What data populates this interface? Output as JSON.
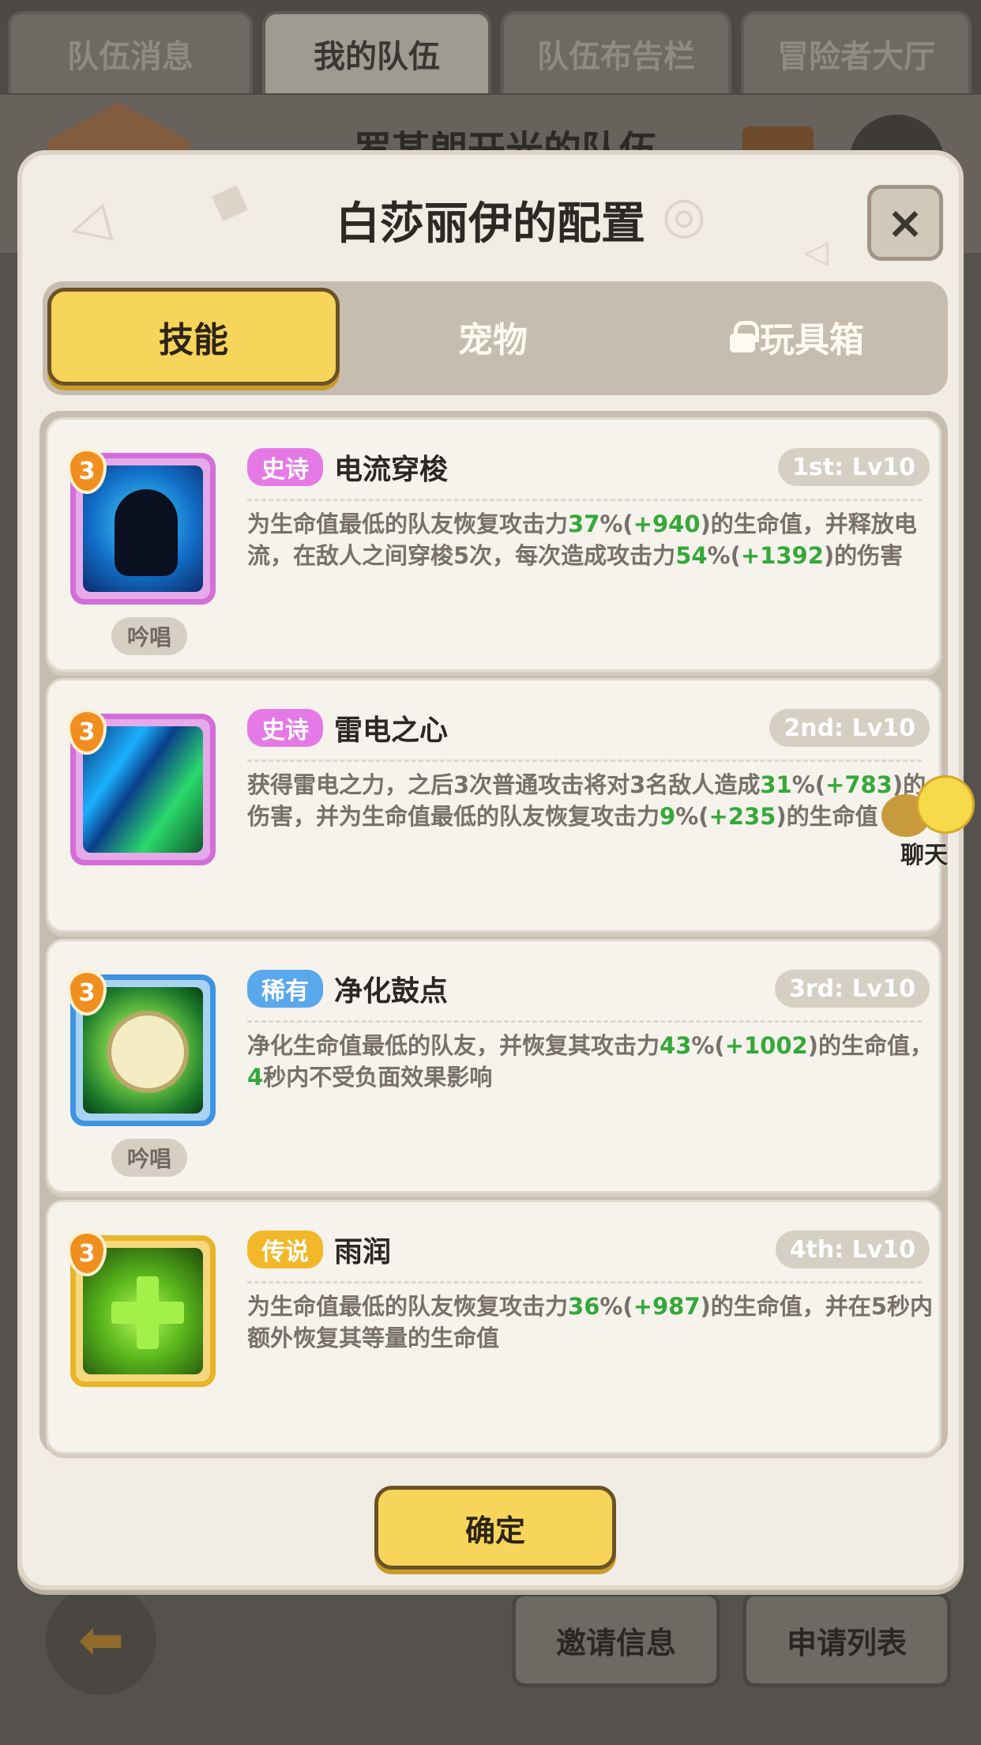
{
  "top_tabs": [
    "队伍消息",
    "我的队伍",
    "队伍布告栏",
    "冒险者大厅"
  ],
  "background": {
    "team_title": "罗某朗开光的队伍",
    "invite_button": "邀请信息",
    "apply_button": "申请列表"
  },
  "modal": {
    "title": "白莎丽伊的配置",
    "close_label": "×",
    "tabs": {
      "skills": "技能",
      "pets": "宠物",
      "toybox": "玩具箱"
    },
    "confirm_label": "确定"
  },
  "skills": [
    {
      "level": "3",
      "rarity": "史诗",
      "rarity_type": "epic",
      "name": "电流穿梭",
      "slot": "1st: Lv10",
      "tag": "吟唱",
      "icon": "lightning-figure-icon",
      "desc": [
        {
          "t": "为生命值最低的队友恢复攻击力"
        },
        {
          "t": "37",
          "g": true
        },
        {
          "t": "%("
        },
        {
          "t": "+940",
          "g": true
        },
        {
          "t": ")的生命值，并释放电流，在敌人之间穿梭5次，每次造成攻击力"
        },
        {
          "t": "54",
          "g": true
        },
        {
          "t": "%("
        },
        {
          "t": "+1392",
          "g": true
        },
        {
          "t": ")的伤害"
        }
      ]
    },
    {
      "level": "3",
      "rarity": "史诗",
      "rarity_type": "epic",
      "name": "雷电之心",
      "slot": "2nd: Lv10",
      "tag": "",
      "icon": "lightning-slash-icon",
      "desc": [
        {
          "t": "获得雷电之力，之后3次普通攻击将对3名敌人造成"
        },
        {
          "t": "31",
          "g": true
        },
        {
          "t": "%("
        },
        {
          "t": "+783",
          "g": true
        },
        {
          "t": ")的伤害，并为生命值最低的队友恢复攻击力"
        },
        {
          "t": "9",
          "g": true
        },
        {
          "t": "%("
        },
        {
          "t": "+235",
          "g": true
        },
        {
          "t": ")的生命值"
        }
      ]
    },
    {
      "level": "3",
      "rarity": "稀有",
      "rarity_type": "rare",
      "name": "净化鼓点",
      "slot": "3rd: Lv10",
      "tag": "吟唱",
      "icon": "purify-drum-icon",
      "desc": [
        {
          "t": "净化生命值最低的队友，并恢复其攻击力"
        },
        {
          "t": "43",
          "g": true
        },
        {
          "t": "%("
        },
        {
          "t": "+1002",
          "g": true
        },
        {
          "t": ")的生命值，"
        },
        {
          "t": "4",
          "g": true
        },
        {
          "t": "秒内不受负面效果影响"
        }
      ]
    },
    {
      "level": "3",
      "rarity": "传说",
      "rarity_type": "legend",
      "name": "雨润",
      "slot": "4th: Lv10",
      "tag": "",
      "icon": "heal-cross-icon",
      "desc": [
        {
          "t": "为生命值最低的队友恢复攻击力"
        },
        {
          "t": "36",
          "g": true
        },
        {
          "t": "%("
        },
        {
          "t": "+987",
          "g": true
        },
        {
          "t": ")的生命值，并在5秒内额外恢复其等量的生命值"
        }
      ]
    }
  ],
  "chat": {
    "label": "聊天"
  }
}
